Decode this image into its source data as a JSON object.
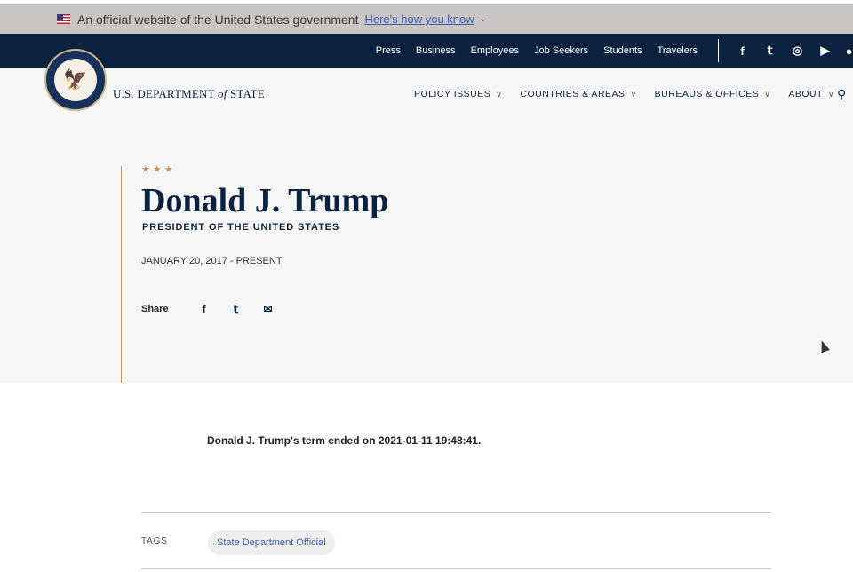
{
  "gov_banner": {
    "text": "An official website of the United States government",
    "link": "Here's how you know",
    "chevron": "⌄"
  },
  "utility_links": [
    "Press",
    "Business",
    "Employees",
    "Job Seekers",
    "Students",
    "Travelers"
  ],
  "social": [
    {
      "name": "facebook-icon",
      "glyph": "f"
    },
    {
      "name": "twitter-icon",
      "glyph": "𝕥"
    },
    {
      "name": "instagram-icon",
      "glyph": "◎"
    },
    {
      "name": "youtube-icon",
      "glyph": "▶"
    },
    {
      "name": "flickr-icon",
      "glyph": "●●"
    }
  ],
  "header": {
    "wordmark_pre": "U.S. DEPARTMENT ",
    "wordmark_of": "of",
    "wordmark_post": " STATE"
  },
  "nav": [
    {
      "label": "POLICY ISSUES"
    },
    {
      "label": "COUNTRIES & AREAS"
    },
    {
      "label": "BUREAUS & OFFICES"
    },
    {
      "label": "ABOUT"
    }
  ],
  "profile": {
    "stars": "★★★",
    "name": "Donald J. Trump",
    "role": "PRESIDENT OF THE UNITED STATES",
    "dates": "JANUARY 20, 2017 - PRESENT",
    "share_label": "Share"
  },
  "body": {
    "ended_text": "Donald J. Trump's term ended on 2021-01-11 19:48:41.",
    "tags_label": "TAGS",
    "tag": "State Department Official"
  },
  "colors": {
    "navy": "#0a2240",
    "gold": "#b99866",
    "link": "#3a5ea8"
  }
}
